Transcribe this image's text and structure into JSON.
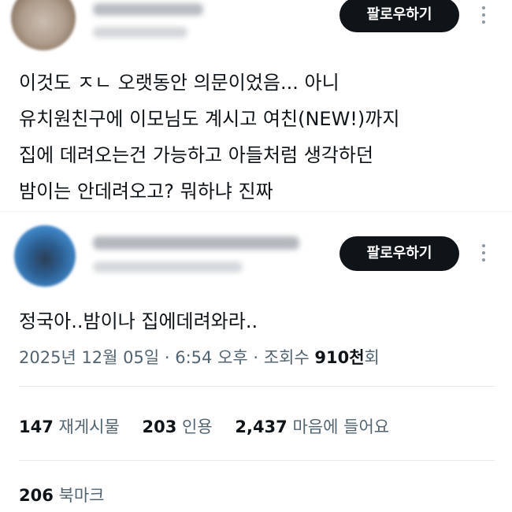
{
  "tweet1": {
    "follow_label": "팔로우하기",
    "lines": [
      "이것도 ㅈㄴ 오랫동안 의문이었음... 아니",
      "유치원친구에 이모님도 계시고 여친(NEW!)까지",
      "집에 데려오는건 가능하고 아들처럼 생각하던",
      "밤이는 안데려오고? 뭐하냐 진짜"
    ]
  },
  "tweet2": {
    "follow_label": "팔로우하기",
    "text": "정국아..밤이나 집에데려와라..",
    "meta": {
      "date": "2025년 12월 05일",
      "sep1": " · ",
      "time": "6:54 오후",
      "sep2": " · ",
      "views_label": "조회수 ",
      "views_num": "910천",
      "views_suffix": "회"
    },
    "stats": [
      {
        "num": "147",
        "label": "재게시물"
      },
      {
        "num": "203",
        "label": "인용"
      },
      {
        "num": "2,437",
        "label": "마음에 들어요"
      }
    ],
    "bookmarks": {
      "num": "206",
      "label": "북마크"
    }
  },
  "colors": {
    "text": "#0f1419",
    "secondary": "#536471",
    "button_bg": "#0f1419",
    "button_text": "#ffffff",
    "divider": "#e7e9ea"
  }
}
